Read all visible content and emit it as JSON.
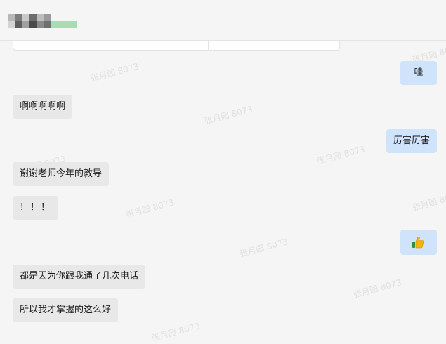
{
  "chat": {
    "title_blurred": "",
    "messages": [
      {
        "side": "out",
        "text": "哇"
      },
      {
        "side": "in",
        "text": "啊啊啊啊啊"
      },
      {
        "side": "out",
        "text": "厉害厉害"
      },
      {
        "side": "in",
        "text": "谢谢老师今年的教导"
      },
      {
        "side": "in",
        "text": "！！！"
      },
      {
        "side": "out",
        "icon": "thumbs-up-icon"
      },
      {
        "side": "in",
        "text": "都是因为你跟我通了几次电话"
      },
      {
        "side": "in",
        "text": "所以我才掌握的这么好"
      }
    ]
  },
  "watermark": {
    "text": "张月园 8073"
  },
  "colors": {
    "background": "#f5f5f5",
    "incoming_bubble": "#e8e8e8",
    "outgoing_bubble": "#cfe3fb",
    "title_blur_green": "#a7dcb5"
  }
}
